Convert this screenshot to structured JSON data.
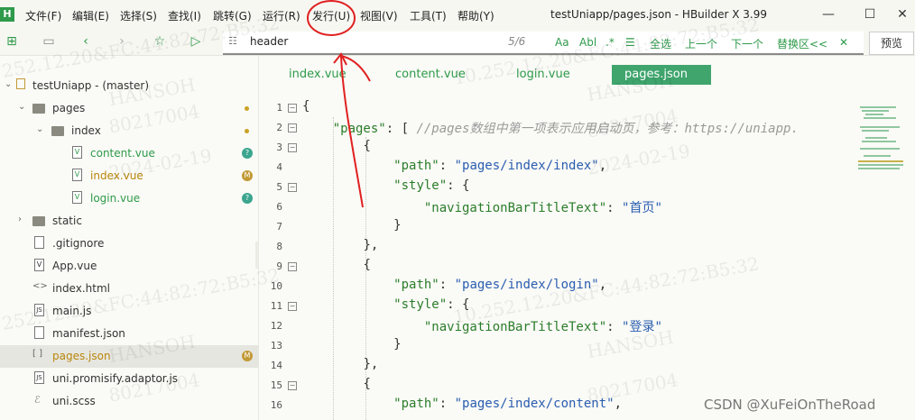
{
  "menu": {
    "app_logo": "H",
    "items": [
      "文件(F)",
      "编辑(E)",
      "选择(S)",
      "查找(I)",
      "跳转(G)",
      "运行(R)",
      "发行(U)",
      "视图(V)",
      "工具(T)",
      "帮助(Y)"
    ],
    "window_title": "testUniapp/pages.json - HBuilder X 3.99",
    "min": "—",
    "max": "☐",
    "close": "✕"
  },
  "toolbar": {
    "search_value": "header",
    "find_count": "5/6",
    "opt_case": "Aa",
    "opt_word": "Abl",
    "opt_regex": ".*",
    "opt_lines": "☰",
    "select_all": "全选",
    "prev": "上一个",
    "next": "下一个",
    "replace": "替换区<<",
    "close": "✕",
    "preview": "预览"
  },
  "sidebar": {
    "project": "testUniapp - (master)",
    "items": [
      {
        "label": "pages"
      },
      {
        "label": "index"
      },
      {
        "label": "content.vue",
        "badge": "?"
      },
      {
        "label": "index.vue",
        "badge": "M"
      },
      {
        "label": "login.vue",
        "badge": "?"
      },
      {
        "label": "static"
      },
      {
        "label": ".gitignore"
      },
      {
        "label": "App.vue"
      },
      {
        "label": "index.html"
      },
      {
        "label": "main.js"
      },
      {
        "label": "manifest.json"
      },
      {
        "label": "pages.json",
        "badge": "M"
      },
      {
        "label": "uni.promisify.adaptor.js"
      },
      {
        "label": "uni.scss"
      }
    ]
  },
  "tabs": [
    "index.vue",
    "content.vue",
    "login.vue",
    "pages.json"
  ],
  "editor": {
    "line_numbers": [
      "1",
      "2",
      "3",
      "4",
      "5",
      "6",
      "7",
      "8",
      "9",
      "10",
      "11",
      "12",
      "13",
      "14",
      "15",
      "16"
    ],
    "comment": "//pages数组中第一项表示应用启动页，参考：https://uniapp.",
    "key_pages": "\"pages\"",
    "key_path": "\"path\"",
    "key_style": "\"style\"",
    "key_title": "\"navigationBarTitleText\"",
    "path_index": "\"pages/index/index\"",
    "path_login": "\"pages/index/login\"",
    "path_content": "\"pages/index/content\"",
    "title_index": "\"首页\"",
    "title_login": "\"登录\""
  },
  "watermark": {
    "ip": "10.252.12.20&FC:44:82:72:B5:32",
    "ip2": "252.12.20&FC:44:82:72:B5:32",
    "ip_frag": "252.12.20&FC:44:82:72:B5:32",
    "name": "HANSOH",
    "id": "80217004",
    "date": "2024-02-19",
    "date2": "2024-02-19"
  },
  "csdn": "CSDN @XuFeiOnTheRoad",
  "colors": {
    "accent": "#2e9a4a",
    "tab_active": "#3fa56d",
    "annotation": "#e02020"
  }
}
